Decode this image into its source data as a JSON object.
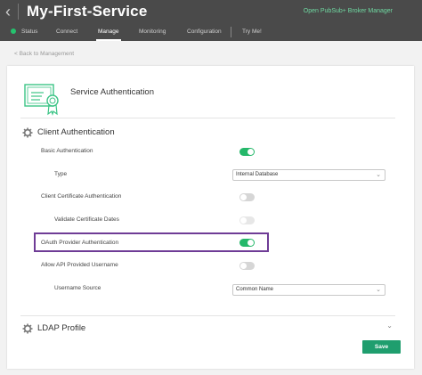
{
  "header": {
    "back_glyph": "‹",
    "title": "My-First-Service",
    "broker_link": "Open PubSub+ Broker Manager",
    "tabs": [
      {
        "label": "Status"
      },
      {
        "label": "Connect"
      },
      {
        "label": "Manage"
      },
      {
        "label": "Monitoring"
      },
      {
        "label": "Configuration"
      },
      {
        "label": "Try Me!"
      }
    ],
    "active_tab": "Manage"
  },
  "breadcrumb": "< Back to Management",
  "card": {
    "title": "Service Authentication",
    "icon": "certificate-icon"
  },
  "client_auth": {
    "title": "Client Authentication",
    "basic_auth": {
      "label": "Basic Authentication",
      "enabled": true
    },
    "type": {
      "label": "Type",
      "value": "Internal Database"
    },
    "client_cert": {
      "label": "Client Certificate Authentication",
      "enabled": false
    },
    "validate_dates": {
      "label": "Validate Certificate Dates",
      "enabled": false
    },
    "oauth": {
      "label": "OAuth Provider Authentication",
      "enabled": true
    },
    "allow_api_username": {
      "label": "Allow API Provided Username",
      "enabled": false
    },
    "username_source": {
      "label": "Username Source",
      "value": "Common Name"
    }
  },
  "ldap": {
    "title": "LDAP Profile"
  },
  "save_label": "Save",
  "colors": {
    "topbar": "#4a4a4a",
    "accent_green": "#25b86a",
    "save_button": "#1f9e6e",
    "highlight_border": "#6f3c96"
  }
}
